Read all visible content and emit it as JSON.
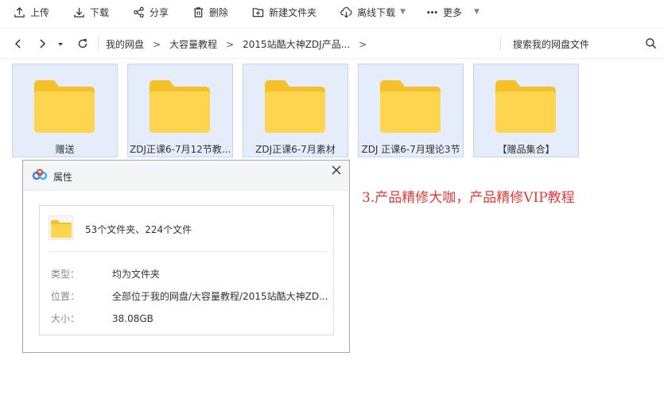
{
  "toolbar": {
    "upload": "上传",
    "download": "下载",
    "share": "分享",
    "delete": "删除",
    "new_folder": "新建文件夹",
    "offline_download": "离线下载",
    "more": "更多"
  },
  "nav": {
    "breadcrumbs": [
      "我的网盘",
      "大容量教程",
      "2015站酷大神ZDJ产品..."
    ],
    "separator": ">",
    "search_placeholder": "搜索我的网盘文件"
  },
  "folders": [
    {
      "name": "赠送"
    },
    {
      "name": "ZDJ正课6-7月12节教..."
    },
    {
      "name": "ZDJ正课6-7月素材"
    },
    {
      "name": "ZDJ 正课6-7月理论3节"
    },
    {
      "name": "【赠品集合】"
    }
  ],
  "dialog": {
    "title": "属性",
    "summary": "53个文件夹、224个文件",
    "rows": [
      {
        "key": "类型：",
        "value": "均为文件夹"
      },
      {
        "key": "位置：",
        "value": "全部位于我的网盘/大容量教程/2015站酷大神ZD..."
      },
      {
        "key": "大小：",
        "value": "38.08GB"
      }
    ]
  },
  "annotation": "3.产品精修大咖，产品精修VIP教程",
  "colors": {
    "folder_yellow": "#ffd54f",
    "folder_tab": "#f5c028",
    "tile_bg": "#e6edfa",
    "annotation_red": "#e53a3a"
  }
}
